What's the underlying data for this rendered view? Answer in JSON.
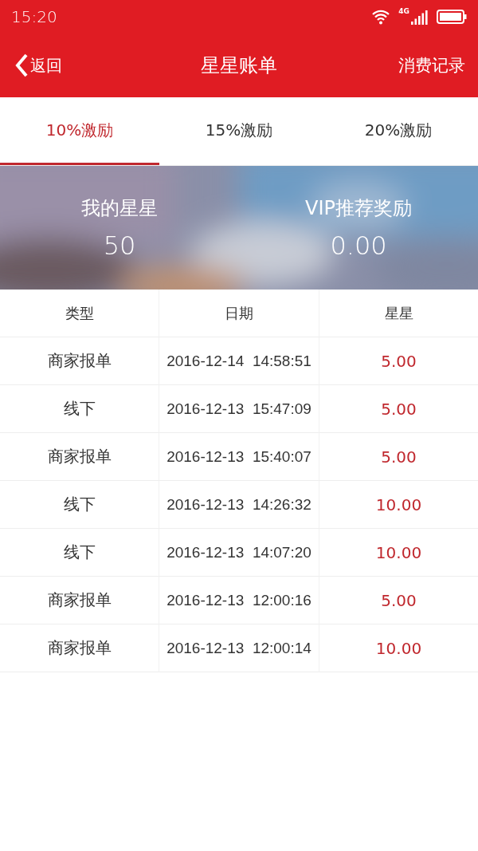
{
  "status_bar": {
    "time": "15:20",
    "network": "4G"
  },
  "header": {
    "back": "返回",
    "title": "星星账单",
    "action": "消费记录"
  },
  "tabs": [
    {
      "label": "10%激励",
      "selected": true
    },
    {
      "label": "15%激励",
      "selected": false
    },
    {
      "label": "20%激励",
      "selected": false
    }
  ],
  "summary": [
    {
      "label": "我的星星",
      "value": "50"
    },
    {
      "label": "VIP推荐奖励",
      "value": "0.00"
    }
  ],
  "table": {
    "columns": [
      "类型",
      "日期",
      "星星"
    ],
    "rows": [
      [
        "商家报单",
        "2016-12-14  14:58:51",
        "5.00"
      ],
      [
        "线下",
        "2016-12-13  15:47:09",
        "5.00"
      ],
      [
        "商家报单",
        "2016-12-13  15:40:07",
        "5.00"
      ],
      [
        "线下",
        "2016-12-13  14:26:32",
        "10.00"
      ],
      [
        "线下",
        "2016-12-13  14:07:20",
        "10.00"
      ],
      [
        "商家报单",
        "2016-12-13  12:00:16",
        "5.00"
      ],
      [
        "商家报单",
        "2016-12-13  12:00:14",
        "10.00"
      ]
    ]
  }
}
